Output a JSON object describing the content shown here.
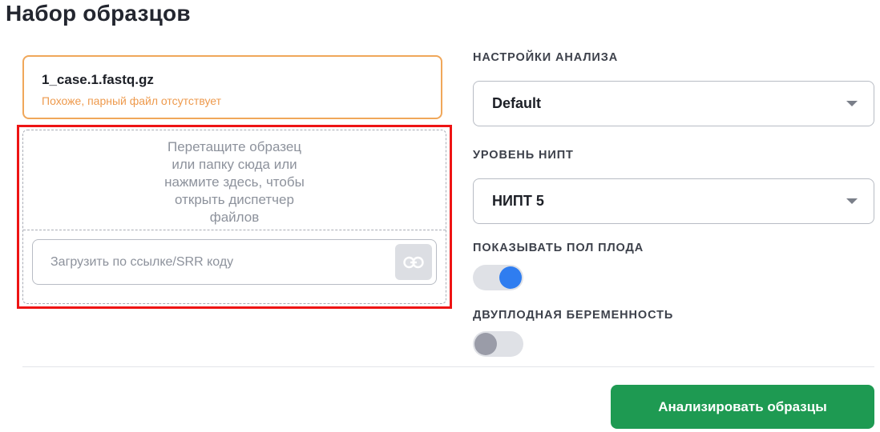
{
  "title": "Набор образцов",
  "file": {
    "name": "1_case.1.fastq.gz",
    "warning": "Похоже, парный файл отсутствует"
  },
  "dropzone": {
    "lines": [
      "Перетащите образец",
      "или папку сюда или",
      "нажмите здесь, чтобы",
      "открыть диспетчер",
      "файлов"
    ],
    "url_placeholder": "Загрузить по ссылке/SRR коду",
    "url_value": ""
  },
  "settings": {
    "analysis_label": "НАСТРОЙКИ АНАЛИЗА",
    "analysis_value": "Default",
    "nipt_label": "УРОВЕНЬ НИПТ",
    "nipt_value": "НИПТ 5",
    "fetal_sex_label": "ПОКАЗЫВАТЬ ПОЛ ПЛОДА",
    "fetal_sex_on": true,
    "twin_label": "ДВУПЛОДНАЯ БЕРЕМЕННОСТЬ",
    "twin_on": false
  },
  "actions": {
    "analyze_label": "Анализировать образцы"
  },
  "colors": {
    "accent_green": "#1e9a52",
    "toggle_on": "#2f7df0",
    "warning_orange": "#ee9a4d",
    "highlight_red": "#ee1414"
  },
  "icons": {
    "link": "link-icon",
    "dropdown": "chevron-down-icon"
  }
}
